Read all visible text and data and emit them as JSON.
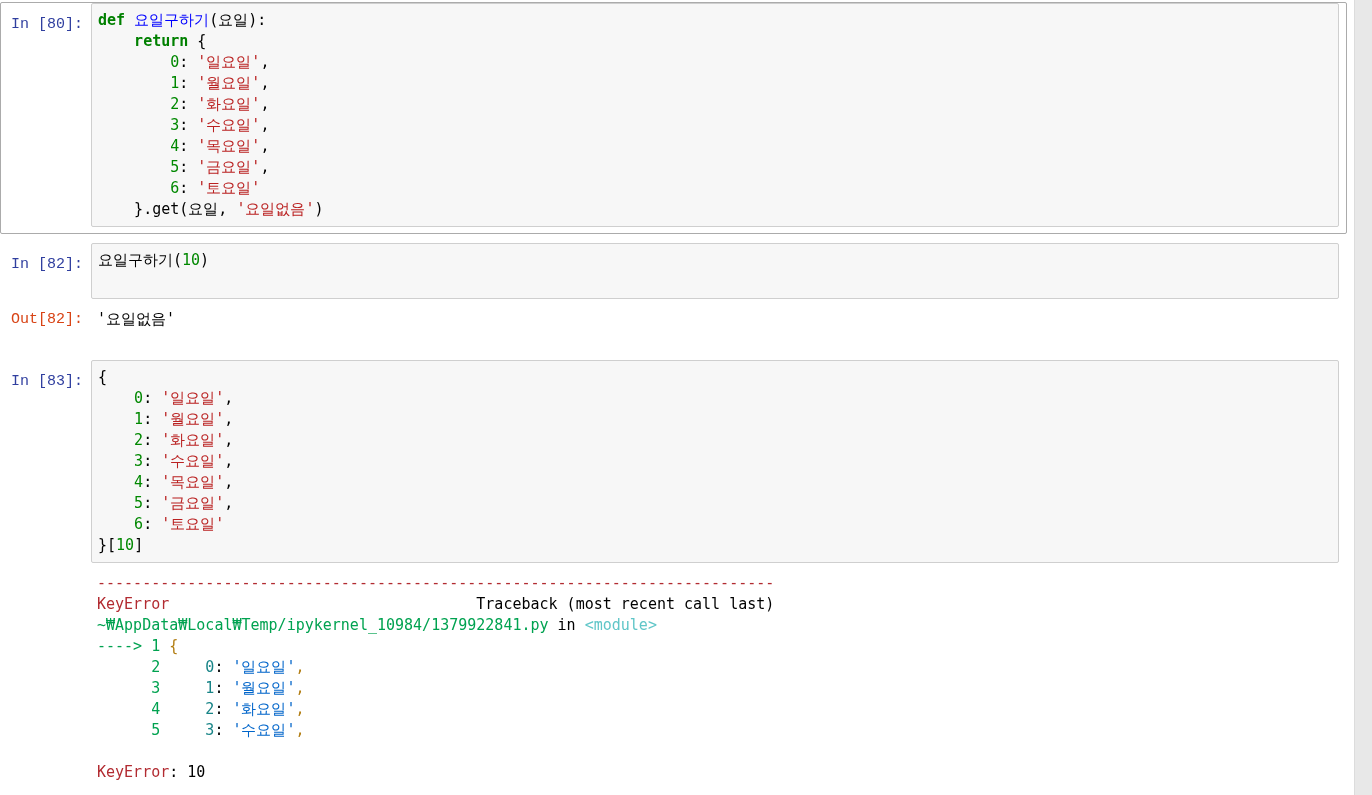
{
  "cells": [
    {
      "prompt": "In [80]:",
      "selected": true,
      "lines": [
        [
          {
            "kind": "kw",
            "text": "def "
          },
          {
            "kind": "fn",
            "text": "요일구하기"
          },
          {
            "kind": "p",
            "text": "(요일):"
          }
        ],
        [
          {
            "kind": "kw",
            "text": "    return"
          },
          {
            "kind": "p",
            "text": " {"
          }
        ],
        [
          {
            "kind": "num",
            "text": "        0"
          },
          {
            "kind": "p",
            "text": ": "
          },
          {
            "kind": "str",
            "text": "'일요일'"
          },
          {
            "kind": "p",
            "text": ","
          }
        ],
        [
          {
            "kind": "num",
            "text": "        1"
          },
          {
            "kind": "p",
            "text": ": "
          },
          {
            "kind": "str",
            "text": "'월요일'"
          },
          {
            "kind": "p",
            "text": ","
          }
        ],
        [
          {
            "kind": "num",
            "text": "        2"
          },
          {
            "kind": "p",
            "text": ": "
          },
          {
            "kind": "str",
            "text": "'화요일'"
          },
          {
            "kind": "p",
            "text": ","
          }
        ],
        [
          {
            "kind": "num",
            "text": "        3"
          },
          {
            "kind": "p",
            "text": ": "
          },
          {
            "kind": "str",
            "text": "'수요일'"
          },
          {
            "kind": "p",
            "text": ","
          }
        ],
        [
          {
            "kind": "num",
            "text": "        4"
          },
          {
            "kind": "p",
            "text": ": "
          },
          {
            "kind": "str",
            "text": "'목요일'"
          },
          {
            "kind": "p",
            "text": ","
          }
        ],
        [
          {
            "kind": "num",
            "text": "        5"
          },
          {
            "kind": "p",
            "text": ": "
          },
          {
            "kind": "str",
            "text": "'금요일'"
          },
          {
            "kind": "p",
            "text": ","
          }
        ],
        [
          {
            "kind": "num",
            "text": "        6"
          },
          {
            "kind": "p",
            "text": ": "
          },
          {
            "kind": "str",
            "text": "'토요일'"
          }
        ],
        [
          {
            "kind": "p",
            "text": "    }.get(요일, "
          },
          {
            "kind": "str",
            "text": "'요일없음'"
          },
          {
            "kind": "p",
            "text": ")"
          }
        ]
      ]
    },
    {
      "prompt": "In [82]:",
      "selected": false,
      "lines": [
        [
          {
            "kind": "p",
            "text": "요일구하기("
          },
          {
            "kind": "num",
            "text": "10"
          },
          {
            "kind": "p",
            "text": ")"
          }
        ]
      ],
      "output": {
        "prompt": "Out[82]:",
        "kind": "result",
        "lines": [
          {
            "kind": "text",
            "tokens": [
              {
                "kind": "p",
                "text": "'요일없음'"
              }
            ]
          }
        ]
      }
    },
    {
      "prompt": "In [83]:",
      "selected": false,
      "lines": [
        [
          {
            "kind": "p",
            "text": "{"
          }
        ],
        [
          {
            "kind": "num",
            "text": "    0"
          },
          {
            "kind": "p",
            "text": ": "
          },
          {
            "kind": "str",
            "text": "'일요일'"
          },
          {
            "kind": "p",
            "text": ","
          }
        ],
        [
          {
            "kind": "num",
            "text": "    1"
          },
          {
            "kind": "p",
            "text": ": "
          },
          {
            "kind": "str",
            "text": "'월요일'"
          },
          {
            "kind": "p",
            "text": ","
          }
        ],
        [
          {
            "kind": "num",
            "text": "    2"
          },
          {
            "kind": "p",
            "text": ": "
          },
          {
            "kind": "str",
            "text": "'화요일'"
          },
          {
            "kind": "p",
            "text": ","
          }
        ],
        [
          {
            "kind": "num",
            "text": "    3"
          },
          {
            "kind": "p",
            "text": ": "
          },
          {
            "kind": "str",
            "text": "'수요일'"
          },
          {
            "kind": "p",
            "text": ","
          }
        ],
        [
          {
            "kind": "num",
            "text": "    4"
          },
          {
            "kind": "p",
            "text": ": "
          },
          {
            "kind": "str",
            "text": "'목요일'"
          },
          {
            "kind": "p",
            "text": ","
          }
        ],
        [
          {
            "kind": "num",
            "text": "    5"
          },
          {
            "kind": "p",
            "text": ": "
          },
          {
            "kind": "str",
            "text": "'금요일'"
          },
          {
            "kind": "p",
            "text": ","
          }
        ],
        [
          {
            "kind": "num",
            "text": "    6"
          },
          {
            "kind": "p",
            "text": ": "
          },
          {
            "kind": "str",
            "text": "'토요일'"
          }
        ],
        [
          {
            "kind": "p",
            "text": "}["
          },
          {
            "kind": "num",
            "text": "10"
          },
          {
            "kind": "p",
            "text": "]"
          }
        ]
      ],
      "output": {
        "kind": "error",
        "lines": [
          {
            "kind": "text",
            "tokens": [
              {
                "kind": "rule",
                "text": "---------------------------------------------------------------------------"
              }
            ]
          },
          {
            "kind": "text",
            "tokens": [
              {
                "kind": "err",
                "text": "KeyError"
              },
              {
                "kind": "p",
                "text": "                                  Traceback (most recent call last)"
              }
            ]
          },
          {
            "kind": "text",
            "tokens": [
              {
                "kind": "path",
                "text": "~₩AppData₩Local₩Temp/ipykernel_10984/1379922841.py"
              },
              {
                "kind": "p",
                "text": " in "
              },
              {
                "kind": "mod",
                "text": "<module>"
              }
            ]
          },
          {
            "kind": "text",
            "tokens": [
              {
                "kind": "path",
                "text": "----> 1 "
              },
              {
                "kind": "brace",
                "text": "{"
              }
            ]
          },
          {
            "kind": "text",
            "tokens": [
              {
                "kind": "lno",
                "text": "      2"
              },
              {
                "kind": "key",
                "text": "     0"
              },
              {
                "kind": "p",
                "text": ": "
              },
              {
                "kind": "ustr",
                "text": "'일요일'"
              },
              {
                "kind": "brace",
                "text": ","
              }
            ]
          },
          {
            "kind": "text",
            "tokens": [
              {
                "kind": "lno",
                "text": "      3"
              },
              {
                "kind": "key",
                "text": "     1"
              },
              {
                "kind": "p",
                "text": ": "
              },
              {
                "kind": "ustr",
                "text": "'월요일'"
              },
              {
                "kind": "brace",
                "text": ","
              }
            ]
          },
          {
            "kind": "text",
            "tokens": [
              {
                "kind": "lno",
                "text": "      4"
              },
              {
                "kind": "key",
                "text": "     2"
              },
              {
                "kind": "p",
                "text": ": "
              },
              {
                "kind": "ustr",
                "text": "'화요일'"
              },
              {
                "kind": "brace",
                "text": ","
              }
            ]
          },
          {
            "kind": "text",
            "tokens": [
              {
                "kind": "lno",
                "text": "      5"
              },
              {
                "kind": "key",
                "text": "     3"
              },
              {
                "kind": "p",
                "text": ": "
              },
              {
                "kind": "ustr",
                "text": "'수요일'"
              },
              {
                "kind": "brace",
                "text": ","
              }
            ]
          },
          {
            "kind": "blank"
          },
          {
            "kind": "text",
            "tokens": [
              {
                "kind": "err",
                "text": "KeyError"
              },
              {
                "kind": "p",
                "text": ": 10"
              }
            ]
          }
        ]
      }
    }
  ]
}
